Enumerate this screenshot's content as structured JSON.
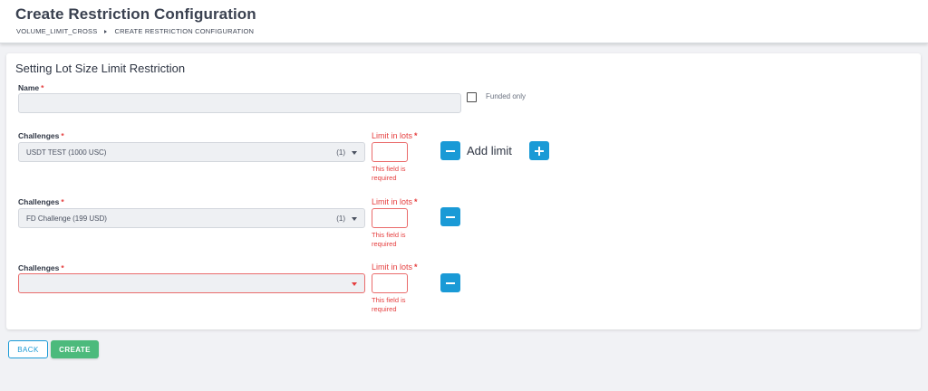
{
  "header": {
    "title": "Create Restriction Configuration",
    "breadcrumb": [
      "VOLUME_LIMIT_CROSS",
      "CREATE RESTRICTION CONFIGURATION"
    ]
  },
  "form": {
    "section_title": "Setting Lot Size Limit Restriction",
    "name": {
      "label": "Name",
      "required_mark": "*",
      "value": ""
    },
    "funded_only": {
      "label": "Funded only",
      "checked": false
    },
    "rows": [
      {
        "challenges_label": "Challenges",
        "challenges_value": "USDT TEST (1000 USC)",
        "challenges_count": "(1)",
        "limit_label": "Limit in lots",
        "limit_value": "",
        "error": "This field is required"
      },
      {
        "challenges_label": "Challenges",
        "challenges_value": "FD Challenge (199 USD)",
        "challenges_count": "(1)",
        "limit_label": "Limit in lots",
        "limit_value": "",
        "error": "This field is required"
      },
      {
        "challenges_label": "Challenges",
        "challenges_value": "",
        "challenges_count": "",
        "limit_label": "Limit in lots",
        "limit_value": "",
        "error": "This field is required"
      }
    ],
    "add_limit_label": "Add limit",
    "required_mark": "*"
  },
  "actions": {
    "back_label": "BACK",
    "create_label": "CREATE"
  },
  "colors": {
    "primary": "#1a9ad6",
    "success": "#4cba7c",
    "error": "#e53e3e"
  }
}
